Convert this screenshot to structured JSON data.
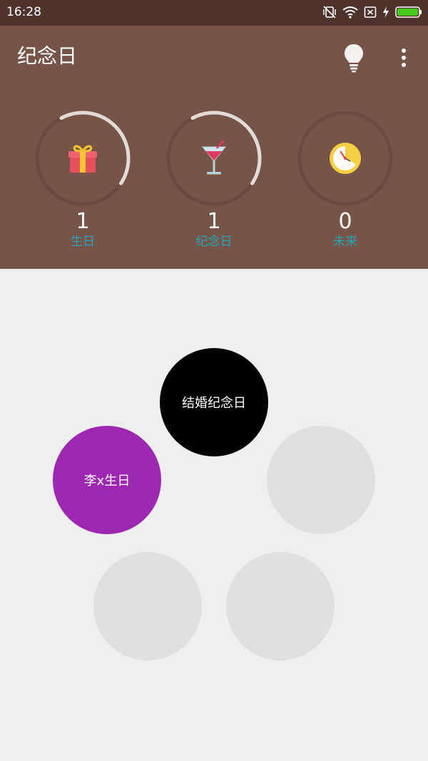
{
  "status_bar": {
    "time": "16:28",
    "icons": [
      "vibrate-off-icon",
      "wifi-icon",
      "sim-off-icon",
      "charging-icon",
      "battery-icon"
    ],
    "battery_color": "#46c81e"
  },
  "header": {
    "title": "纪念日",
    "actions": [
      "lightbulb-icon",
      "more-vert-icon"
    ],
    "background": "#765548"
  },
  "stats": [
    {
      "count": "1",
      "label": "生日",
      "icon": "gift-icon",
      "progress": 0.42
    },
    {
      "count": "1",
      "label": "纪念日",
      "icon": "cocktail-icon",
      "progress": 0.42
    },
    {
      "count": "0",
      "label": "未来",
      "icon": "clock-icon",
      "progress": 0
    }
  ],
  "bubbles": [
    {
      "label": "结婚纪念日",
      "color": "#000000"
    },
    {
      "label": "李x生日",
      "color": "#9c27b0"
    },
    {
      "label": "",
      "color": "#e0e0e0"
    },
    {
      "label": "",
      "color": "#e0e0e0"
    },
    {
      "label": "",
      "color": "#e0e0e0"
    }
  ]
}
